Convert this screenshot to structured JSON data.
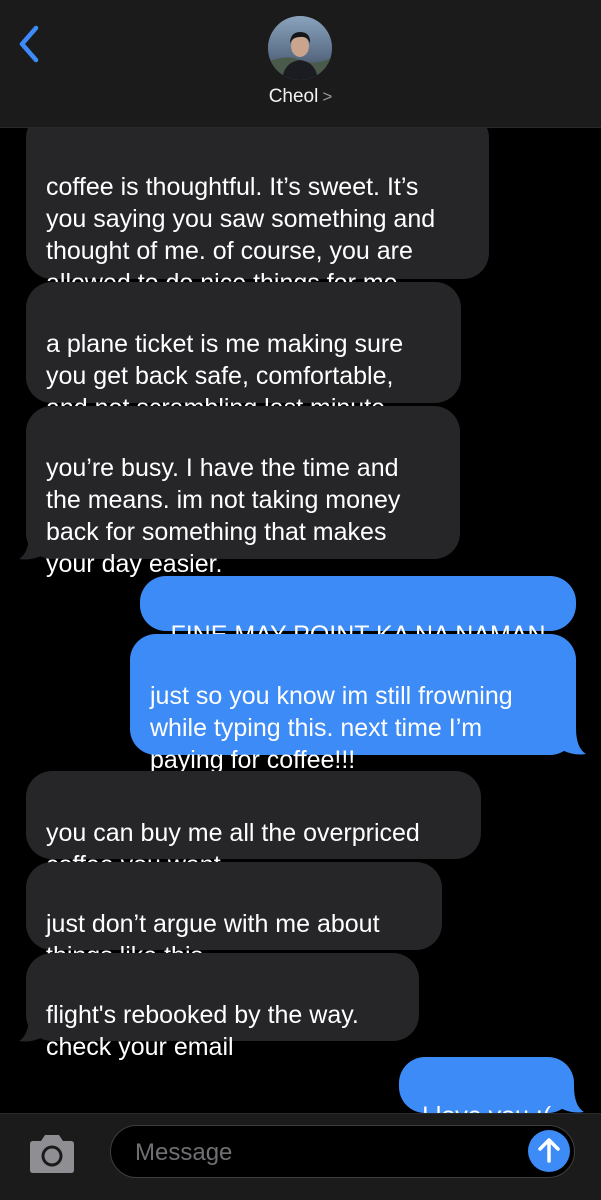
{
  "header": {
    "back_icon": "chevron-left-icon",
    "contact_name": "Cheol",
    "contact_chevron": ">",
    "accent_color": "#3d8bf7"
  },
  "messages": [
    {
      "direction": "incoming",
      "text": "coffee is thoughtful. It’s sweet. It’s\nyou saying you saw something and\nthought of me. of course, you are\nallowed to do nice things for me."
    },
    {
      "direction": "incoming",
      "text": "a plane ticket is me making sure\nyou get back safe, comfortable,\nand not scrambling last minute"
    },
    {
      "direction": "incoming",
      "text": "you’re busy. I have the time and\nthe means. im not taking money\nback for something that makes\nyour day easier."
    },
    {
      "direction": "outgoing",
      "text": "FINE MAY POINT KA NA NAMAN"
    },
    {
      "direction": "outgoing",
      "text": "just so you know im still frowning\nwhile typing this. next time I’m\npaying for coffee!!!"
    },
    {
      "direction": "incoming",
      "text": "you can buy me all the overpriced\ncoffee you want"
    },
    {
      "direction": "incoming",
      "text": "just don’t argue with me about\nthings like this"
    },
    {
      "direction": "incoming",
      "text": "flight's rebooked by the way.\ncheck your email"
    },
    {
      "direction": "outgoing",
      "text": "I love you :("
    }
  ],
  "composer": {
    "placeholder": "Message",
    "camera_icon": "camera-icon",
    "send_icon": "arrow-up-icon"
  },
  "colors": {
    "incoming_bubble": "#262629",
    "outgoing_bubble": "#3d8bf7",
    "background": "#000000",
    "bar_background": "#1b1b1b"
  }
}
